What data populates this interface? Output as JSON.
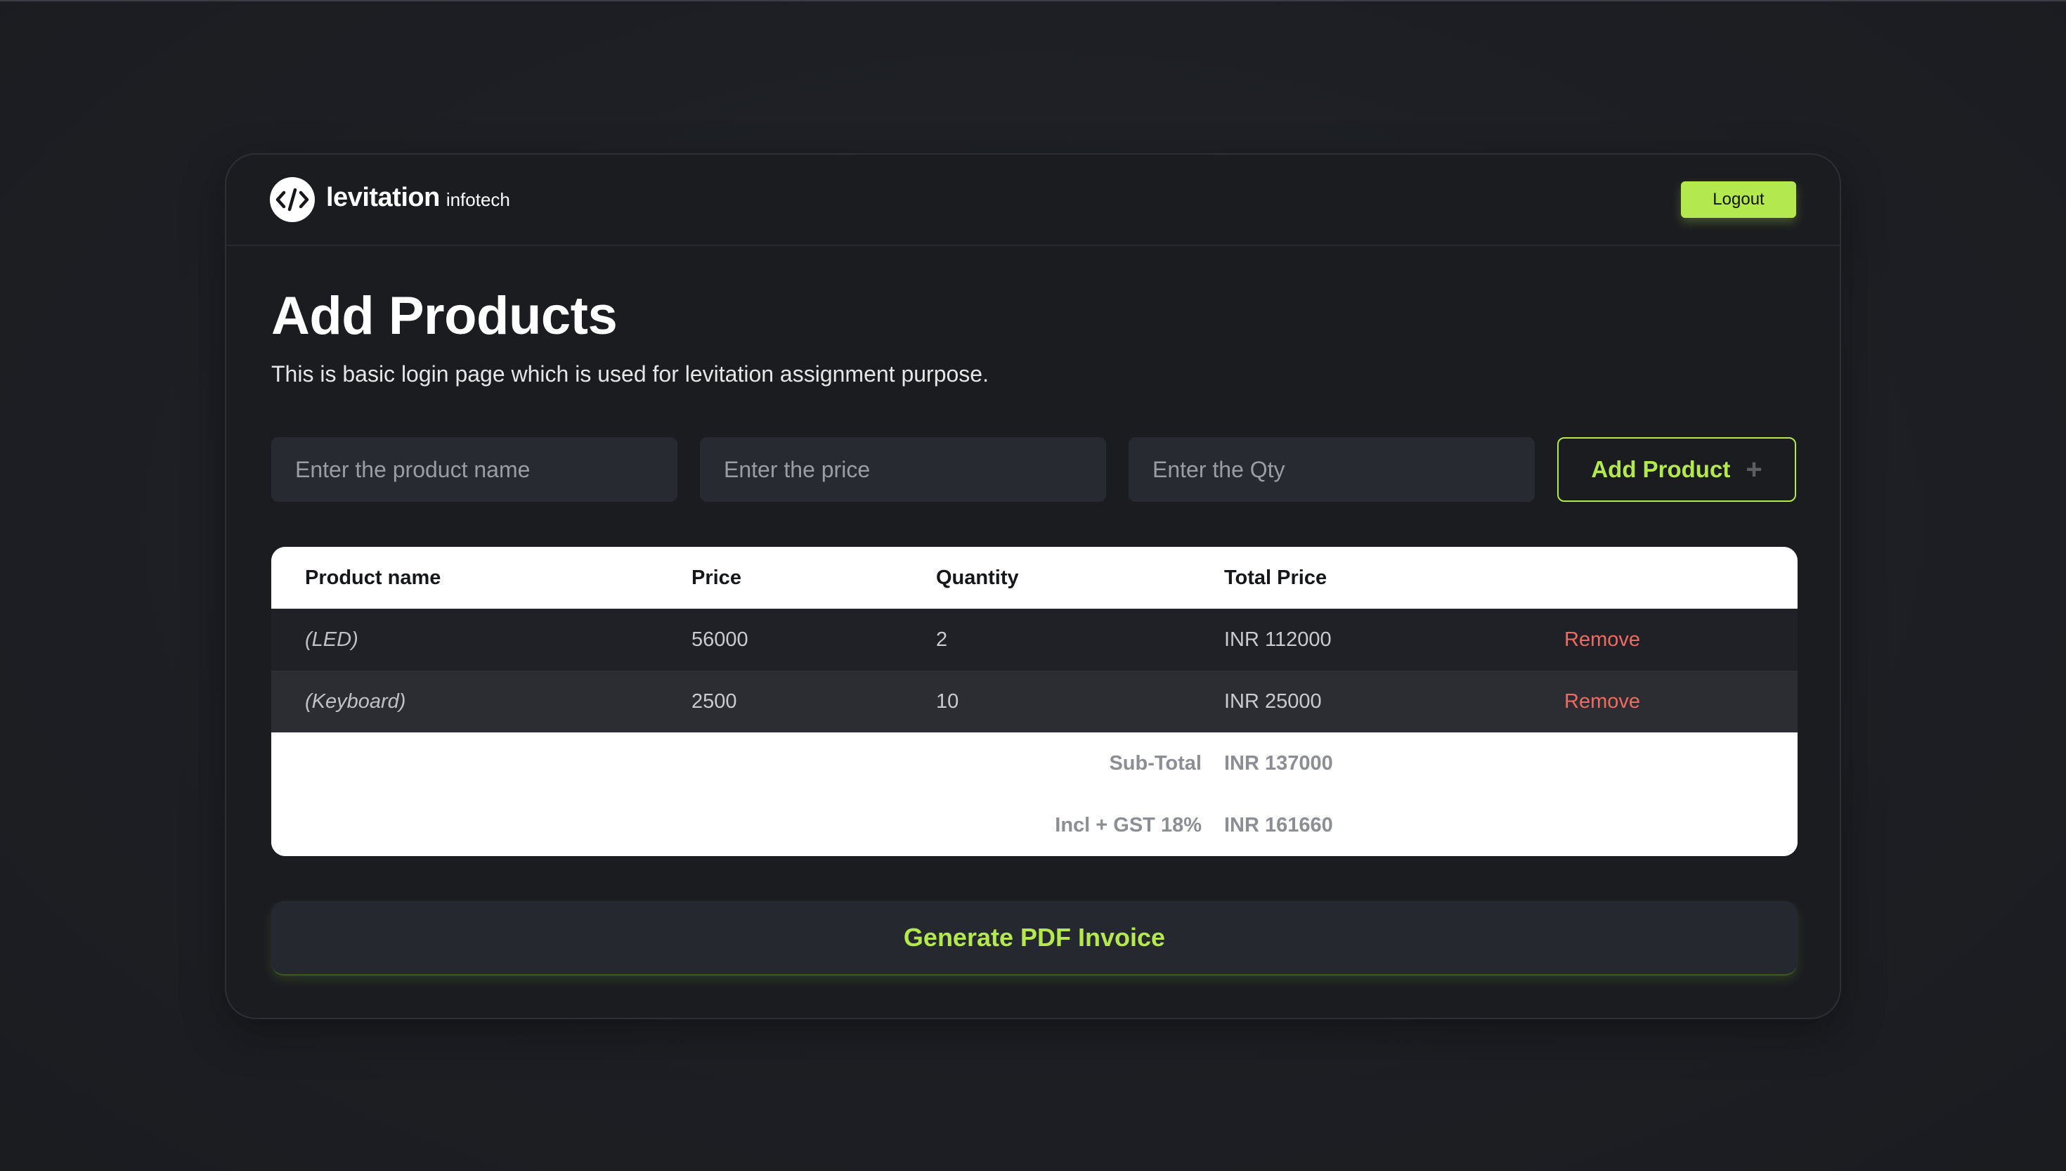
{
  "header": {
    "brand_name": "levitation",
    "brand_suffix": "infotech",
    "logout_label": "Logout"
  },
  "page": {
    "title": "Add Products",
    "subtitle": "This is basic login page which is used for levitation assignment purpose."
  },
  "form": {
    "product_name_placeholder": "Enter the product name",
    "price_placeholder": "Enter the price",
    "qty_placeholder": "Enter the Qty",
    "add_label": "Add Product"
  },
  "table": {
    "headers": [
      "Product name",
      "Price",
      "Quantity",
      "Total Price"
    ],
    "rows": [
      {
        "name": "(LED)",
        "price": "56000",
        "qty": "2",
        "total": "INR 112000",
        "action": "Remove"
      },
      {
        "name": "(Keyboard)",
        "price": "2500",
        "qty": "10",
        "total": "INR 25000",
        "action": "Remove"
      }
    ],
    "subtotal_label": "Sub-Total",
    "subtotal_value": "INR 137000",
    "gst_label": "Incl + GST 18%",
    "gst_value": "INR 161660"
  },
  "actions": {
    "generate_label": "Generate PDF Invoice"
  },
  "colors": {
    "accent": "#b4e84f",
    "danger": "#ec6b62",
    "card_bg": "#1b1c20",
    "page_bg": "#1d1f24"
  },
  "icons": {
    "logo": "code-brackets-icon",
    "add": "plus-icon"
  }
}
